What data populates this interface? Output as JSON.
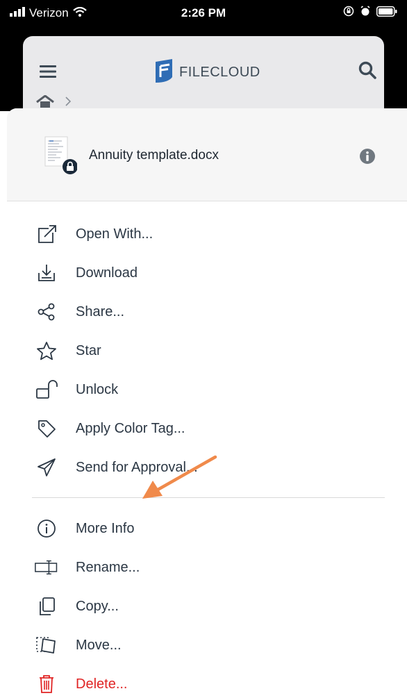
{
  "status_bar": {
    "carrier": "Verizon",
    "time": "2:26 PM"
  },
  "app": {
    "logo_text": "FILECLOUD"
  },
  "file": {
    "name": "Annuity template.docx"
  },
  "menu": {
    "group1": [
      "Open With...",
      "Download",
      "Share...",
      "Star",
      "Unlock",
      "Apply Color Tag...",
      "Send for Approval..."
    ],
    "group2": [
      "More Info",
      "Rename...",
      "Copy...",
      "Move...",
      "Delete..."
    ]
  },
  "colors": {
    "accent": "#2f6db5",
    "text": "#2b3744",
    "danger": "#e02424",
    "arrow": "#f08a4b"
  }
}
